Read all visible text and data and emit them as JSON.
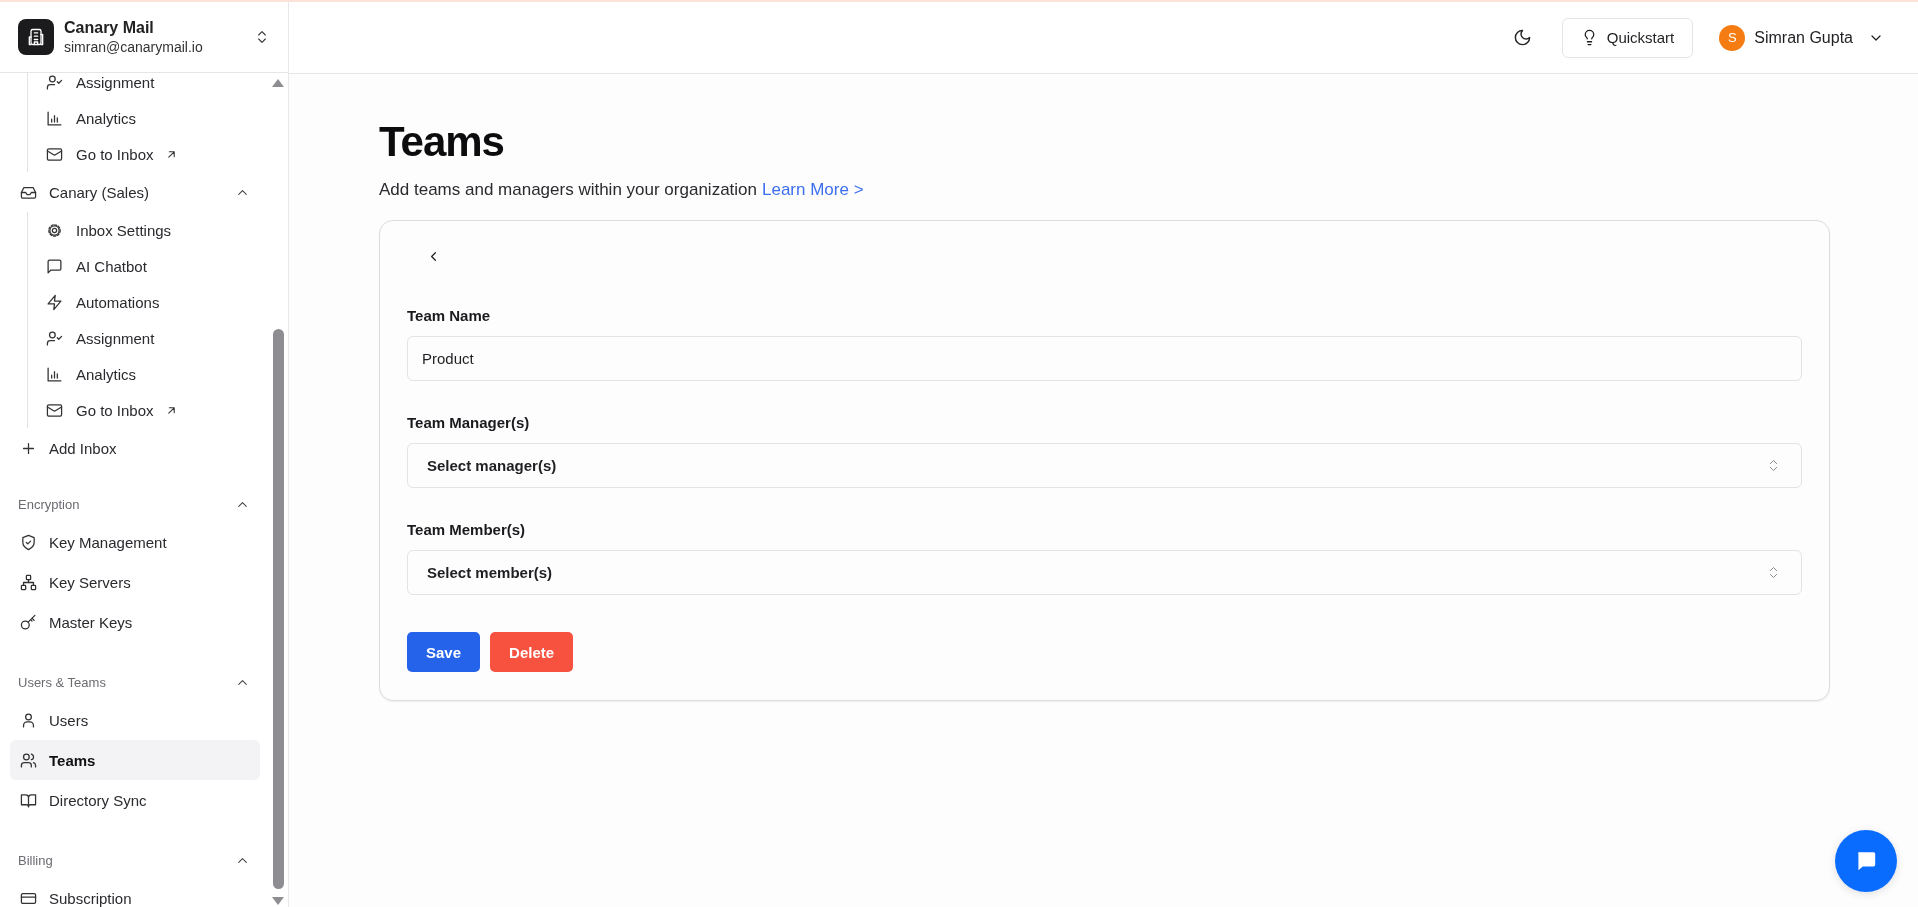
{
  "workspace": {
    "name": "Canary Mail",
    "email": "simran@canarymail.io"
  },
  "sidebar": {
    "sections": [
      {
        "items": [
          {
            "children": [
              {
                "label": "Assignment",
                "kind": "assignment",
                "selected": false
              },
              {
                "label": "Analytics",
                "kind": "analytics",
                "selected": false
              },
              {
                "label": "Go to Inbox",
                "kind": "external",
                "selected": false
              }
            ]
          },
          {
            "label": "Canary (Sales)",
            "kind": "inbox",
            "expanded": true,
            "selected": false,
            "children": [
              {
                "label": "Inbox Settings",
                "kind": "settings",
                "selected": false
              },
              {
                "label": "AI Chatbot",
                "kind": "chatbot",
                "selected": false
              },
              {
                "label": "Automations",
                "kind": "automations",
                "selected": false
              },
              {
                "label": "Assignment",
                "kind": "assignment",
                "selected": false
              },
              {
                "label": "Analytics",
                "kind": "analytics",
                "selected": false
              },
              {
                "label": "Go to Inbox",
                "kind": "external",
                "selected": false
              }
            ]
          },
          {
            "label": "Add Inbox",
            "kind": "add",
            "selected": false
          }
        ]
      },
      {
        "title": "Encryption",
        "expanded": true,
        "items": [
          {
            "label": "Key Management",
            "kind": "shield",
            "selected": false
          },
          {
            "label": "Key Servers",
            "kind": "servers",
            "selected": false
          },
          {
            "label": "Master Keys",
            "kind": "key",
            "selected": false
          }
        ]
      },
      {
        "title": "Users & Teams",
        "expanded": true,
        "items": [
          {
            "label": "Users",
            "kind": "user",
            "selected": false
          },
          {
            "label": "Teams",
            "kind": "users",
            "selected": true
          },
          {
            "label": "Directory Sync",
            "kind": "book",
            "selected": false
          }
        ]
      },
      {
        "title": "Billing",
        "expanded": true,
        "items": [
          {
            "label": "Subscription",
            "kind": "card",
            "selected": false
          }
        ]
      }
    ]
  },
  "header": {
    "quickstart": "Quickstart",
    "user": {
      "initial": "S",
      "name": "Simran Gupta"
    }
  },
  "page": {
    "title": "Teams",
    "subtitle": "Add teams and managers within your organization",
    "link": "Learn More >"
  },
  "form": {
    "fields": [
      {
        "label": "Team Name",
        "kind": "text",
        "value": "Product"
      },
      {
        "label": "Team Manager(s)",
        "kind": "select",
        "placeholder": "Select manager(s)"
      },
      {
        "label": "Team Member(s)",
        "kind": "select",
        "placeholder": "Select member(s)"
      }
    ],
    "buttons": [
      {
        "label": "Save",
        "kind": "primary"
      },
      {
        "label": "Delete",
        "kind": "danger"
      }
    ]
  }
}
